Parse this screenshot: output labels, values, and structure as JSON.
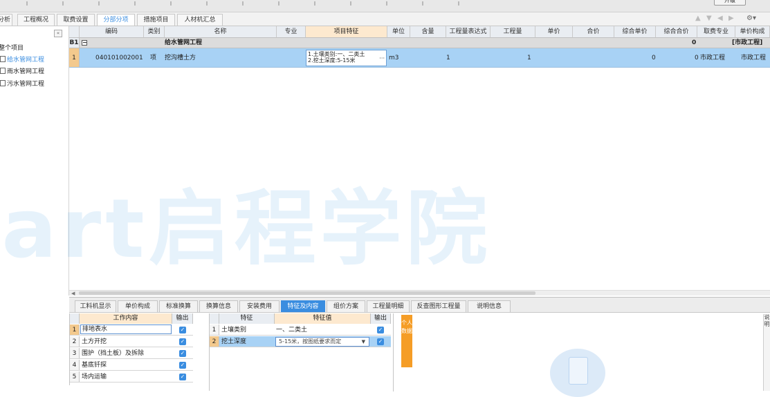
{
  "top_button": "升级",
  "tabs": [
    "分析",
    "工程概况",
    "取费设置",
    "分部分项",
    "措施项目",
    "人材机汇总"
  ],
  "active_tab": "分部分项",
  "sidebar": {
    "root": "整个项目",
    "items": [
      "给水管网工程",
      "雨水管网工程",
      "污水管网工程"
    ]
  },
  "grid": {
    "headers": [
      "编码",
      "类别",
      "名称",
      "专业",
      "项目特征",
      "单位",
      "含量",
      "工程量表达式",
      "工程量",
      "单价",
      "合价",
      "综合单价",
      "综合合价",
      "取费专业",
      "单价构成"
    ],
    "group_row": {
      "id": "B1",
      "name": "给水管网工程",
      "total": "0",
      "fee": "[市政工程]"
    },
    "rows": [
      {
        "num": "1",
        "code": "040101002001",
        "type": "项",
        "name": "挖沟槽土方",
        "feature_line1": "1.土壤类别:一、二类土",
        "feature_line2": "2.挖土深度:5-15米",
        "unit": "m3",
        "content": "1",
        "quantity": "1",
        "combined_unit": "0",
        "combined_total": "0",
        "fee_major": "市政工程",
        "price_composition": "市政工程"
      }
    ]
  },
  "watermark": "tart启程学院",
  "bottom_tabs": [
    "工料机显示",
    "单价构成",
    "标准换算",
    "换算信息",
    "安装费用",
    "特征及内容",
    "组价方案",
    "工程量明细",
    "反查图形工程量",
    "说明信息"
  ],
  "active_bottom_tab": "特征及内容",
  "work_table": {
    "headers": [
      "工作内容",
      "输出"
    ],
    "rows": [
      {
        "num": "1",
        "label": "排地表水"
      },
      {
        "num": "2",
        "label": "土方开挖"
      },
      {
        "num": "3",
        "label": "围护（挡土板）及拆除"
      },
      {
        "num": "4",
        "label": "基底钎探"
      },
      {
        "num": "5",
        "label": "场内运输"
      }
    ]
  },
  "feature_table": {
    "headers": [
      "特征",
      "特征值",
      "输出"
    ],
    "rows": [
      {
        "num": "1",
        "label": "土壤类别",
        "value": "一、二类土"
      },
      {
        "num": "2",
        "label": "挖土深度",
        "value": "5-15米，按图纸要求而定"
      }
    ]
  },
  "personal_tab": "个人数据",
  "right_strip": "说明"
}
